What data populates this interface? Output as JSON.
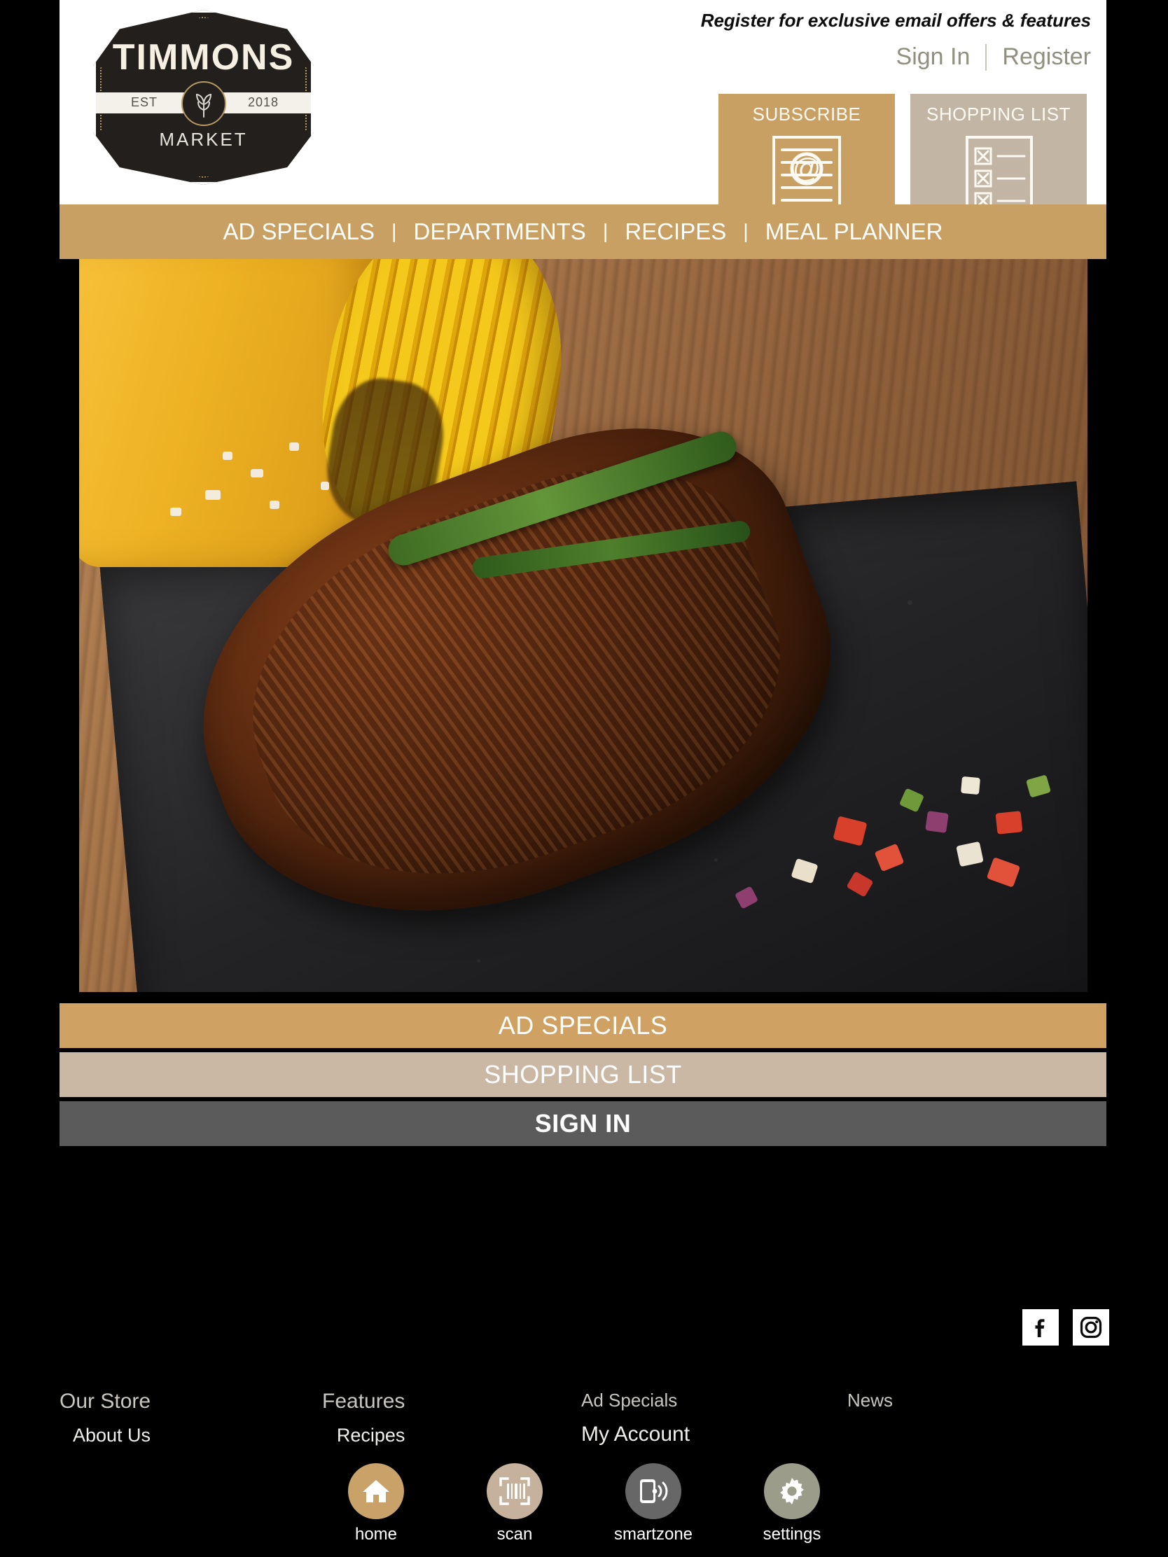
{
  "brand": {
    "name": "TIMMONS",
    "sub": "MARKET",
    "est_label": "EST",
    "est_year": "2018",
    "logo_icon": "wheat-sheaf-icon"
  },
  "header": {
    "tagline": "Register for exclusive email offers & features",
    "sign_in": "Sign In",
    "register": "Register",
    "divider": "|",
    "promo_tiles": [
      {
        "label": "SUBSCRIBE",
        "icon": "email-newsletter-icon",
        "bg": "#c9a063"
      },
      {
        "label": "SHOPPING LIST",
        "icon": "checklist-icon",
        "bg": "#c3b5a4"
      }
    ]
  },
  "nav": {
    "separator": "|",
    "items": [
      {
        "label": "AD SPECIALS"
      },
      {
        "label": "DEPARTMENTS"
      },
      {
        "label": "RECIPES"
      },
      {
        "label": "MEAL PLANNER"
      }
    ]
  },
  "hero": {
    "alt": "grilled-steak-on-slate-with-corn-and-rosemary"
  },
  "actions": [
    {
      "label": "AD SPECIALS",
      "bg": "#cfa264"
    },
    {
      "label": "SHOPPING LIST",
      "bg": "#cbb8a4"
    },
    {
      "label": "SIGN IN",
      "bg": "#5b5b5b"
    }
  ],
  "social": [
    {
      "name": "facebook-icon",
      "glyph": "f"
    },
    {
      "name": "instagram-icon",
      "glyph": "camera"
    }
  ],
  "footer": {
    "columns": [
      {
        "primary": "Our Store",
        "secondary": "About Us"
      },
      {
        "primary": "Features",
        "secondary": "Recipes"
      },
      {
        "primary": "Ad Specials",
        "secondary": "My Account"
      },
      {
        "primary": "News",
        "secondary": ""
      }
    ]
  },
  "tabbar": {
    "tabs": [
      {
        "label": "home",
        "icon": "home-icon",
        "bg": "#c8a268",
        "active": true
      },
      {
        "label": "scan",
        "icon": "barcode-scan-icon",
        "bg": "#c5b19c",
        "active": false
      },
      {
        "label": "smartzone",
        "icon": "phone-signal-icon",
        "bg": "#676767",
        "active": false
      },
      {
        "label": "settings",
        "icon": "gear-icon",
        "bg": "#9c9c8a",
        "active": false
      }
    ]
  },
  "colors": {
    "gold": "#c9a063",
    "taupe": "#c3b5a4",
    "dark_gray": "#5b5b5b",
    "olive_text": "#918f7e",
    "background": "#000000"
  }
}
